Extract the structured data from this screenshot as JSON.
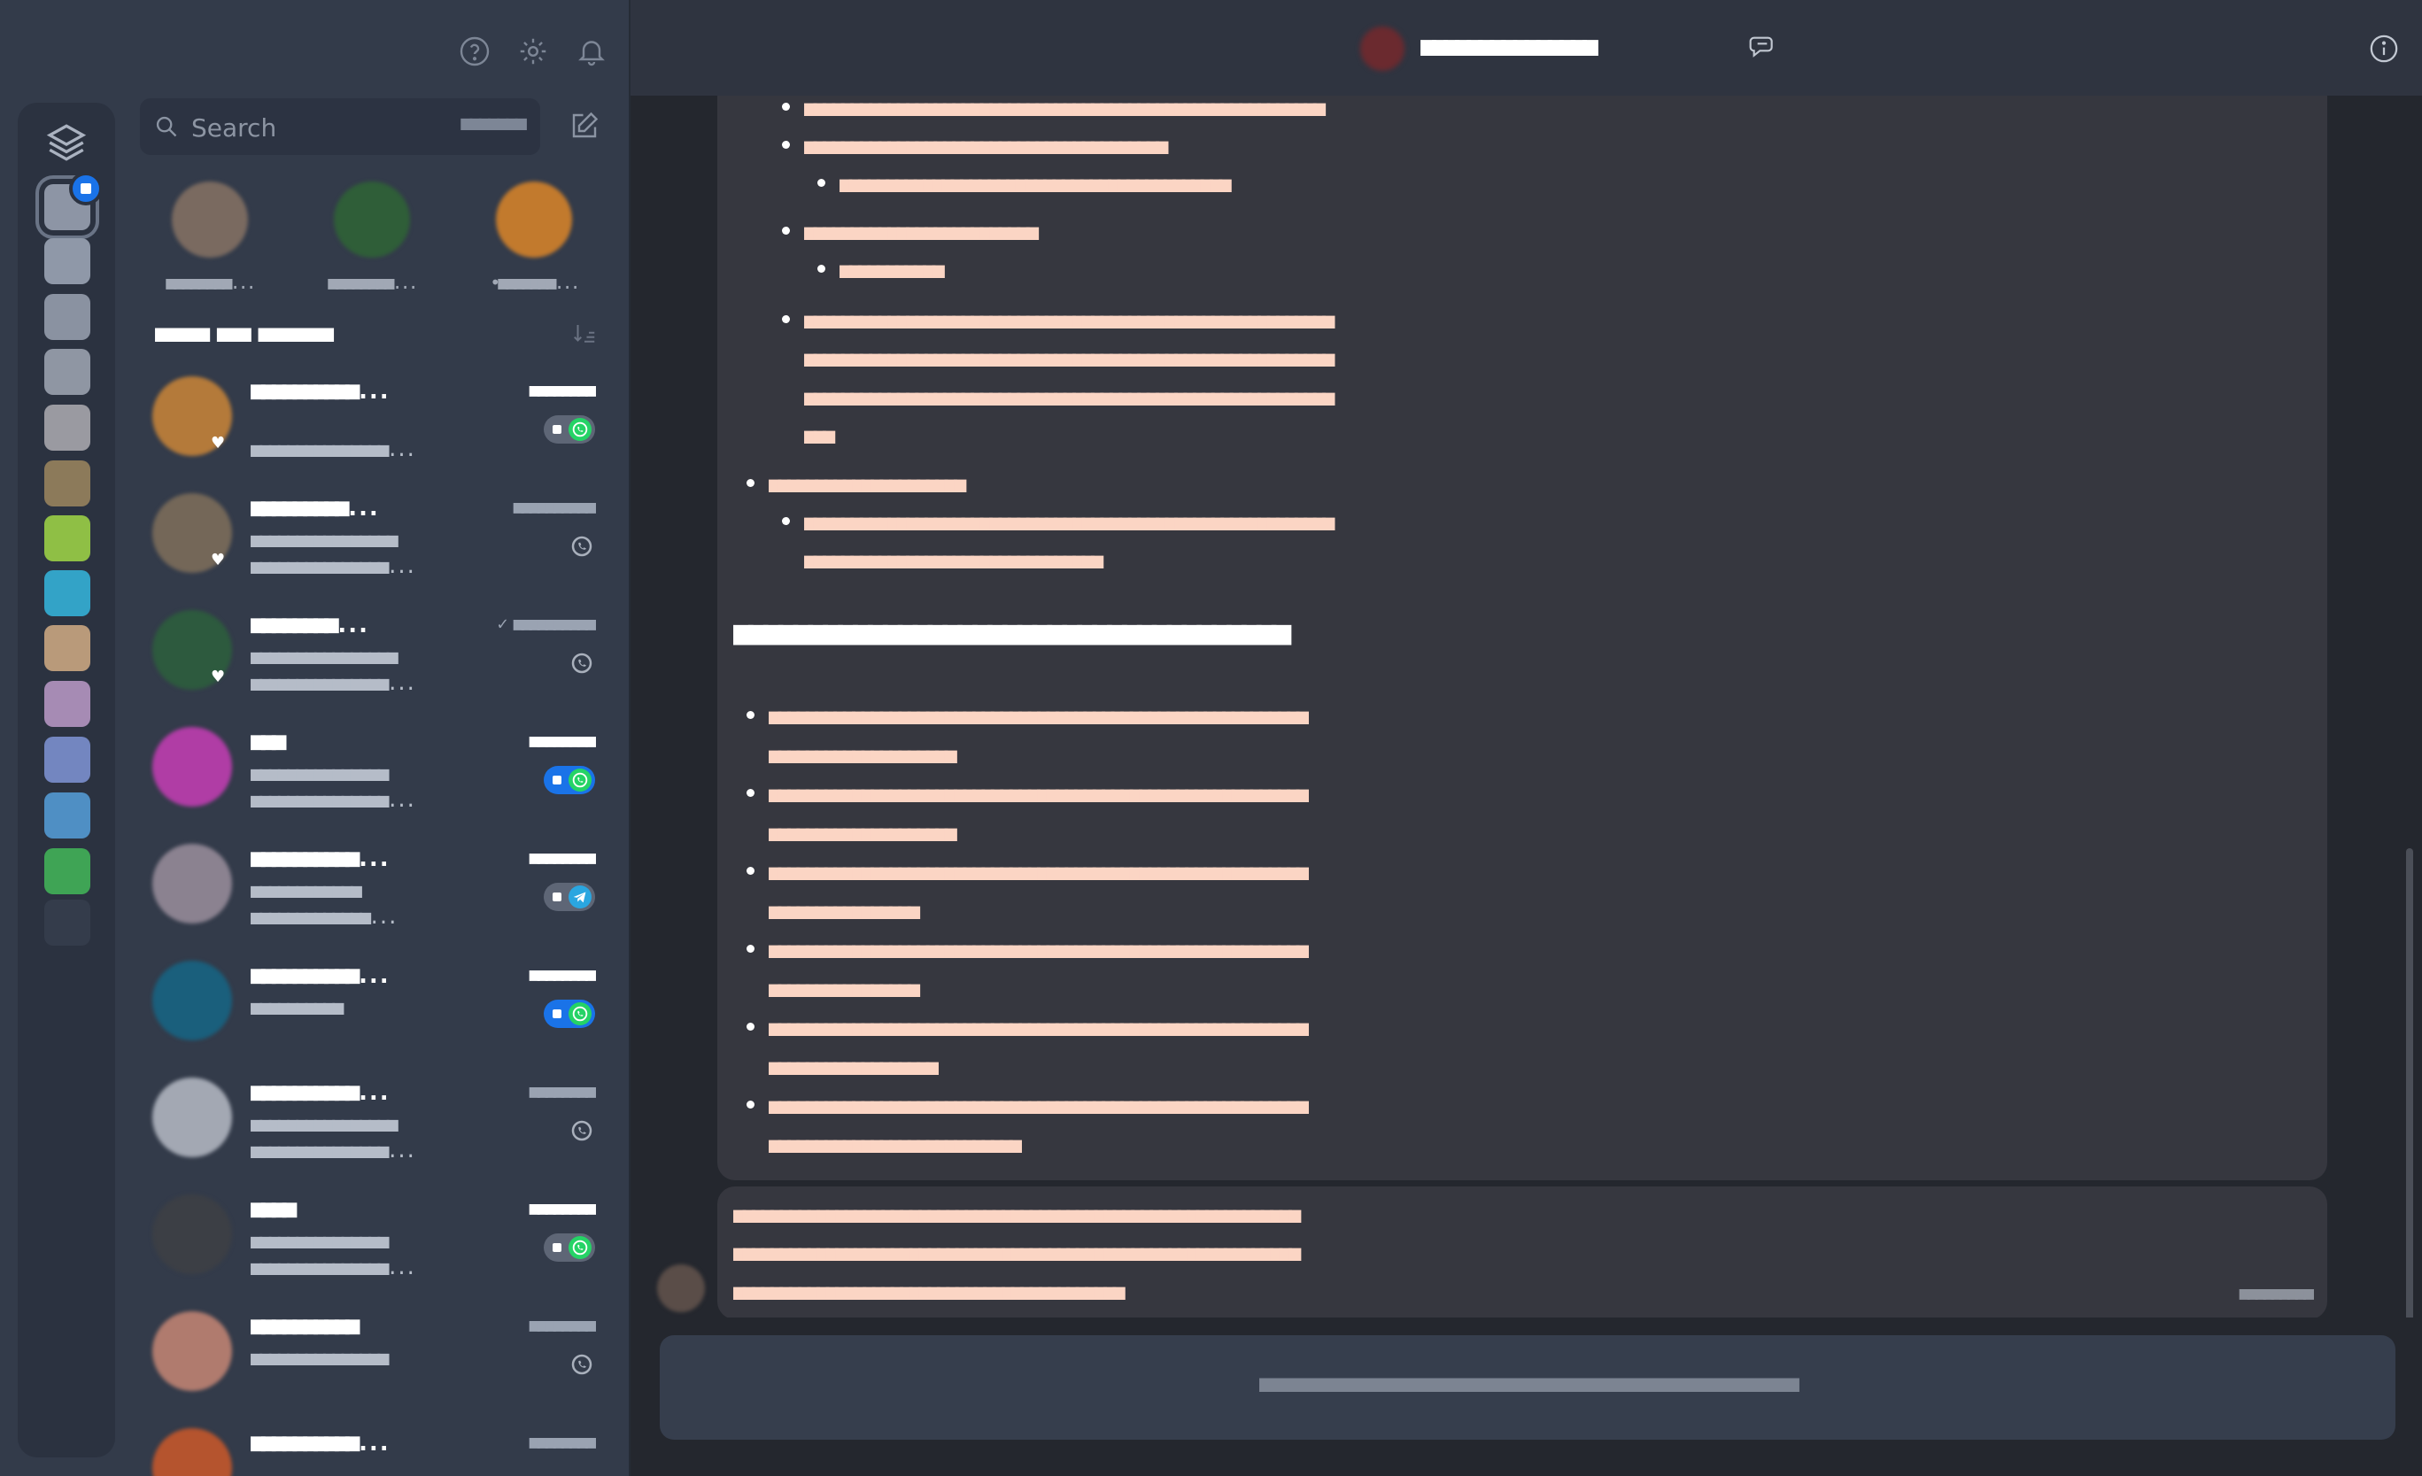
{
  "toolbar": {
    "help_icon": "help-circle-icon",
    "settings_icon": "gear-icon",
    "notifications_icon": "bell-icon"
  },
  "rail": {
    "top_icon": "layers-icon",
    "badge_color": "#1a73e8",
    "items": [
      {
        "name": "rail-account-1",
        "color": "#8d95a5",
        "selected": true
      },
      {
        "name": "rail-account-2",
        "color": "#8f98a8"
      },
      {
        "name": "rail-account-3",
        "color": "#8a92a1"
      },
      {
        "name": "rail-account-4",
        "color": "#8f96a3"
      },
      {
        "name": "rail-account-5",
        "color": "#9a9aa1"
      },
      {
        "name": "rail-account-6",
        "color": "#8c7a5a"
      },
      {
        "name": "rail-account-7",
        "color": "#8fbf45"
      },
      {
        "name": "rail-account-8",
        "color": "#33a3c7"
      },
      {
        "name": "rail-account-9",
        "color": "#b99a7a"
      },
      {
        "name": "rail-account-10",
        "color": "#a68bb4"
      },
      {
        "name": "rail-account-11",
        "color": "#7386c0"
      },
      {
        "name": "rail-account-12",
        "color": "#4f8fc4"
      },
      {
        "name": "rail-account-13",
        "color": "#3fa455"
      },
      {
        "name": "rail-account-14",
        "color": "#343c4b"
      }
    ]
  },
  "search": {
    "placeholder": "Search",
    "shortcut": "■■■■■■■"
  },
  "pinned": [
    {
      "name": "■■■■■■■■...",
      "color": "#7a6a60"
    },
    {
      "name": "■■■■■■■■...",
      "color": "#2f5e38"
    },
    {
      "name": "•■■■■■■■...",
      "color": "#c27a2d"
    }
  ],
  "section": {
    "title": "■■■■■ ■■■ ■■■■■■■",
    "icon": "sort-icon"
  },
  "chats": [
    {
      "name": "■■■■■■■■■■...",
      "time": "■■■■■■■■",
      "time_dim": false,
      "prev1": "",
      "prev2": "■■■■■■■■■■■■■■■...",
      "avatar": "#b47a3a",
      "heart": true,
      "badge": "pill",
      "pill_color": "#5e6676",
      "logo_color": "#25d366",
      "logo": "whatsapp"
    },
    {
      "name": "■■■■■■■■■...",
      "time": "■■■■■■■■■■",
      "time_dim": true,
      "prev1": "■■■■■■■■■■■■■■■■",
      "prev2": "■■■■■■■■■■■■■■■...",
      "avatar": "#746758",
      "heart": true,
      "badge": "icon",
      "logo": "whatsapp"
    },
    {
      "name": "■■■■■■■■...",
      "time": "✓ ■■■■■■■■■■",
      "time_dim": true,
      "prev1": "■■■■■■■■■■■■■■■■",
      "prev2": "■■■■■■■■■■■■■■■...",
      "avatar": "#2d5a3e",
      "heart": true,
      "badge": "icon",
      "logo": "whatsapp"
    },
    {
      "name": "■■■",
      "time": "■■■■■■■■",
      "time_dim": false,
      "prev1": "■■■■■■■■■■■■■■■",
      "prev2": "■■■■■■■■■■■■■■■...",
      "avatar": "#b03da5",
      "heart": false,
      "badge": "pill",
      "pill_color": "#1a73e8",
      "logo_color": "#25d366",
      "logo": "whatsapp"
    },
    {
      "name": "■■■■■■■■■■...",
      "time": "■■■■■■■■",
      "time_dim": false,
      "prev1": "■■■■■■■■■■■■",
      "prev2": "■■■■■■■■■■■■■...",
      "avatar": "#8b8290",
      "heart": false,
      "badge": "pill",
      "pill_color": "#5e6676",
      "logo_color": "#2aa6e0",
      "logo": "telegram"
    },
    {
      "name": "■■■■■■■■■■...",
      "time": "■■■■■■■■",
      "time_dim": false,
      "prev1": "■■■■■■■■■■",
      "prev2": "",
      "avatar": "#1a5f7c",
      "heart": false,
      "badge": "pill",
      "pill_color": "#1a73e8",
      "logo_color": "#25d366",
      "logo": "whatsapp"
    },
    {
      "name": "■■■■■■■■■■...",
      "time": "■■■■■■■■",
      "time_dim": true,
      "prev1": "■■■■■■■■■■■■■■■■",
      "prev2": "■■■■■■■■■■■■■■■...",
      "avatar": "#a3a8b3",
      "heart": false,
      "badge": "icon",
      "logo": "whatsapp"
    },
    {
      "name": "■■■■",
      "time": "■■■■■■■■",
      "time_dim": false,
      "prev1": "■■■■■■■■■■■■■■■",
      "prev2": "■■■■■■■■■■■■■■■...",
      "avatar": "#3c3f45",
      "heart": false,
      "badge": "pill",
      "pill_color": "#5e6676",
      "logo_color": "#25d366",
      "logo": "whatsapp"
    },
    {
      "name": "■■■■■■■■■■",
      "time": "■■■■■■■■",
      "time_dim": true,
      "prev1": "■■■■■■■■■■■■■■■",
      "prev2": "",
      "avatar": "#b07b6e",
      "heart": false,
      "badge": "icon",
      "logo": "whatsapp"
    },
    {
      "name": "■■■■■■■■■■...",
      "time": "■■■■■■■■",
      "time_dim": true,
      "prev1": "",
      "prev2": "",
      "avatar": "#b5542e",
      "heart": false,
      "badge": "none",
      "logo": "whatsapp"
    }
  ],
  "conversation": {
    "contact_name": "■■■■■■■■■■■■■■■",
    "avatar_color": "#6b2a2f",
    "chat_icon": "chat-bubble-icon",
    "info_icon": "info-icon",
    "message1": {
      "lines": [
        {
          "text": "■■■■■■■■■■■■■■■■■■■■■■■■■■■■■■■■■■■■■■■■■■■■■■■■■■■■■■■■",
          "bullet": true,
          "level": 2
        },
        {
          "text": "■■■■■■■■■■■■■■■■■■■■■■■■■■■■■■■■■■■■■■■",
          "bullet": true,
          "level": 2
        },
        {
          "text": "■■■■■■■■■■■■■■■■■■■■■■■■■■■■■■■■■■■■■■■■■■",
          "bullet": true,
          "level": 3
        },
        {
          "text": "■■■■■■■■■■■■■■■■■■■■■■■■■",
          "bullet": true,
          "level": 2
        },
        {
          "text": "■■■■■■■■■■■",
          "bullet": true,
          "level": 3
        },
        {
          "text": "■■■■■■■■■■■■■■■■■■■■■■■■■■■■■■■■■■■■■■■■■■■■■■■■■■■■■■■■■",
          "bullet": true,
          "level": 2
        },
        {
          "text": "■■■■■■■■■■■■■■■■■■■■■■■■■■■■■■■■■■■■■■■■■■■■■■■■■■■■■■■■■",
          "bullet": false,
          "level": 2
        },
        {
          "text": "■■■■■■■■■■■■■■■■■■■■■■■■■■■■■■■■■■■■■■■■■■■■■■■■■■■■■■■■■",
          "bullet": false,
          "level": 2
        },
        {
          "text": "■■■",
          "bullet": false,
          "level": 2
        },
        {
          "text": "■■■■■■■■■■■■■■■■■■■■■",
          "bullet": true,
          "level": 1
        },
        {
          "text": "■■■■■■■■■■■■■■■■■■■■■■■■■■■■■■■■■■■■■■■■■■■■■■■■■■■■■■■■■",
          "bullet": true,
          "level": 2
        },
        {
          "text": "■■■■■■■■■■■■■■■■■■■■■■■■■■■■■■■■",
          "bullet": false,
          "level": 2
        }
      ],
      "heading": "■■■■■■■■■■■■■■■■■■■■■■■■■■■■■■■■■■■■■",
      "items": [
        [
          "■■■■■■■■■■■■■■■■■■■■■■■■■■■■■■■■■■■■■■■■■■■■■■■■■■■■■■■■■■",
          "■■■■■■■■■■■■■■■■■■■■"
        ],
        [
          "■■■■■■■■■■■■■■■■■■■■■■■■■■■■■■■■■■■■■■■■■■■■■■■■■■■■■■■■■■",
          "■■■■■■■■■■■■■■■■■■■■"
        ],
        [
          "■■■■■■■■■■■■■■■■■■■■■■■■■■■■■■■■■■■■■■■■■■■■■■■■■■■■■■■■■■",
          "■■■■■■■■■■■■■■■■"
        ],
        [
          "■■■■■■■■■■■■■■■■■■■■■■■■■■■■■■■■■■■■■■■■■■■■■■■■■■■■■■■■■■",
          "■■■■■■■■■■■■■■■■"
        ],
        [
          "■■■■■■■■■■■■■■■■■■■■■■■■■■■■■■■■■■■■■■■■■■■■■■■■■■■■■■■■■■",
          "■■■■■■■■■■■■■■■■■■"
        ],
        [
          "■■■■■■■■■■■■■■■■■■■■■■■■■■■■■■■■■■■■■■■■■■■■■■■■■■■■■■■■■■",
          "■■■■■■■■■■■■■■■■■■■■■■■■■■■"
        ]
      ]
    },
    "message2": {
      "lines": [
        "■■■■■■■■■■■■■■■■■■■■■■■■■■■■■■■■■■■■■■■■■■■■■■■■■■■■■■■■■■■■■",
        "■■■■■■■■■■■■■■■■■■■■■■■■■■■■■■■■■■■■■■■■■■■■■■■■■■■■■■■■■■■■■",
        "■■■■■■■■■■■■■■■■■■■■■■■■■■■■■■■■■■■■■■■■■■"
      ],
      "time": "■■■■■■■■■"
    },
    "sender_avatar_color": "#5a4d48",
    "composer_text": "■■■■■■■■■■■■■■■■■■■■■■■■■■■■■■■■■■■■■■■■■■■■■■■■■■■■"
  }
}
